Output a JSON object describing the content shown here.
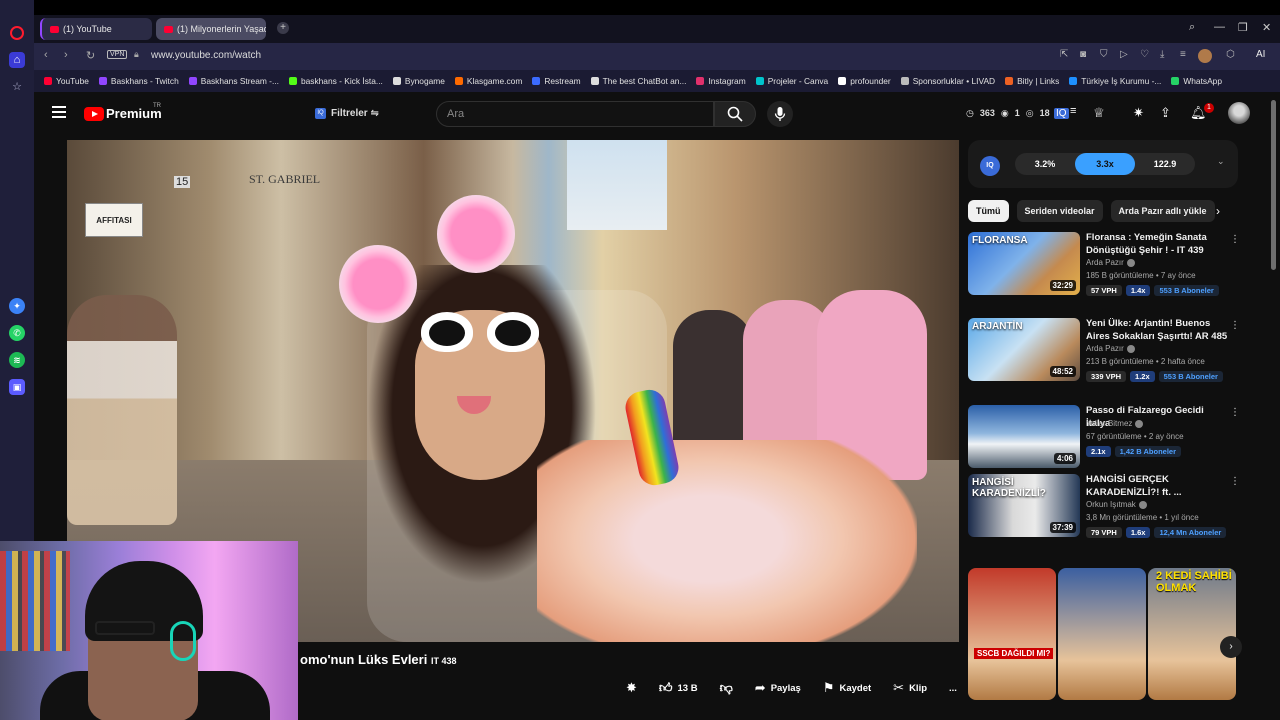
{
  "browser": {
    "tabs": [
      {
        "title": "(1) YouTube",
        "active": true
      },
      {
        "title": "(1) Milyonerlerin Yaşadığı",
        "active": false
      }
    ],
    "new_tab_label": "+",
    "url": "www.youtube.com/watch",
    "vpn_label": "VPN",
    "ai_label": "AI",
    "bookmarks": [
      {
        "label": "YouTube",
        "color": "#ff0033"
      },
      {
        "label": "Baskhans - Twitch",
        "color": "#9146ff"
      },
      {
        "label": "Baskhans Stream -...",
        "color": "#9146ff"
      },
      {
        "label": "baskhans - Kick İsta...",
        "color": "#53fc18"
      },
      {
        "label": "Bynogame",
        "color": "#dddddd"
      },
      {
        "label": "Klasgame.com",
        "color": "#ff6a00"
      },
      {
        "label": "Restream",
        "color": "#3b6bff"
      },
      {
        "label": "The best ChatBot an...",
        "color": "#dddddd"
      },
      {
        "label": "Instagram",
        "color": "#e1306c"
      },
      {
        "label": "Projeler - Canva",
        "color": "#00c4cc"
      },
      {
        "label": "profounder",
        "color": "#ffffff"
      },
      {
        "label": "Sponsorluklar • LIVAD",
        "color": "#bbbbbb"
      },
      {
        "label": "Bitly | Links",
        "color": "#ee6123"
      },
      {
        "label": "Türkiye İş Kurumu -...",
        "color": "#1e90ff"
      },
      {
        "label": "WhatsApp",
        "color": "#25d366"
      }
    ]
  },
  "youtube": {
    "brand": "Premium",
    "brand_tm": "TR",
    "filter_icon": "IQ",
    "filters_label": "Filtreler",
    "search_placeholder": "Ara",
    "stats": {
      "a": "363",
      "b": "1",
      "c": "18"
    },
    "notification_count": "1",
    "video": {
      "sign_text": "AFFITASI",
      "shop_text": "ST. GABRIEL",
      "door_number": "15",
      "title": "omo'nun Lüks Evleri",
      "title_tag": "IT 438"
    },
    "actions": {
      "likes": "13 B",
      "share": "Paylaş",
      "save": "Kaydet",
      "clip": "Klip",
      "more": "..."
    },
    "iq_panel": {
      "logo": "IQ",
      "pills": [
        "3.2%",
        "3.3x",
        "122.9"
      ],
      "active_index": 1
    },
    "chips": [
      "Tümü",
      "Seriden videolar",
      "Arda Pazır adlı yükle"
    ],
    "recommendations": [
      {
        "title": "Floransa : Yemeğin Sanata Dönüştüğü Şehir ! - IT 439",
        "channel": "Arda Pazır",
        "views": "185 B görüntüleme • 7 ay önce",
        "duration": "32:29",
        "thumb_text": "FLORANSA",
        "vph": "57 VPH",
        "ratio": "1.4x",
        "subs": "553 B Aboneler"
      },
      {
        "title": "Yeni Ülke: Arjantin! Buenos Aires Sokakları Şaşırttı! AR 485",
        "channel": "Arda Pazır",
        "views": "213 B görüntüleme • 2 hafta önce",
        "duration": "48:52",
        "thumb_text": "ARJANTİN",
        "vph": "339 VPH",
        "ratio": "1.2x",
        "subs": "553 B Aboneler"
      },
      {
        "title": "Passo di Falzarego Gecidi İtalya",
        "channel": "Yollar Bitmez",
        "views": "67 görüntüleme • 2 ay önce",
        "duration": "4:06",
        "thumb_text": "",
        "vph": "",
        "ratio": "2.1x",
        "subs": "1,42 B Aboneler"
      },
      {
        "title": "HANGİSİ GERÇEK KARADENİZLİ?! ft. ...",
        "channel": "Orkun Işıtmak",
        "views": "3,8 Mn görüntüleme • 1 yıl önce",
        "duration": "37:39",
        "thumb_text": "HANGİSİ KARADENİZLİ?",
        "vph": "79 VPH",
        "ratio": "1.6x",
        "subs": "12,4 Mn Aboneler"
      }
    ],
    "shorts": [
      {
        "caption": "SSCB DAĞILDI MI?",
        "color": "#c23a2a"
      },
      {
        "caption": "",
        "color": "#3b5fa0"
      },
      {
        "caption": "2 KEDİ SAHİBİ OLMAK",
        "color": "#6f7a8a"
      }
    ]
  }
}
